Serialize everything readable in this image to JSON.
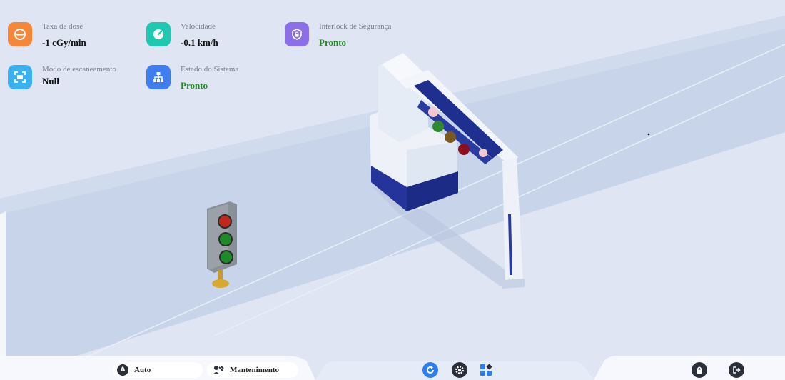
{
  "metrics": {
    "dose_rate": {
      "label": "Taxa de dose",
      "value": "-1 cGy/min",
      "icon": "speedometer-icon",
      "color": "#f5873a"
    },
    "speed": {
      "label": "Velocidade",
      "value": "-0.1 km/h",
      "icon": "gauge-icon",
      "color": "#1fc8b0"
    },
    "interlock": {
      "label": "Interlock de Segurança",
      "value": "Pronto",
      "icon": "shield-lock-icon",
      "color": "#8b6ee8"
    },
    "scan_mode": {
      "label": "Modo de escaneamento",
      "value": "Null",
      "icon": "scan-frame-icon",
      "color": "#3ab0ef"
    },
    "system_state": {
      "label": "Estado do Sistema",
      "value": "Pronto",
      "icon": "sitemap-icon",
      "color": "#3f7ef0"
    }
  },
  "toolbar": {
    "auto_label": "Auto",
    "auto_icon": "A",
    "maintenance_label": "Mantenimento",
    "center_icons": [
      "refresh-icon",
      "gear-icon",
      "grid-icon"
    ],
    "right_icons": [
      "lock-icon",
      "logout-icon"
    ]
  },
  "colors": {
    "ok": "#1f8a1f",
    "accent": "#2b7ff0",
    "dark": "#2b2f3a"
  }
}
